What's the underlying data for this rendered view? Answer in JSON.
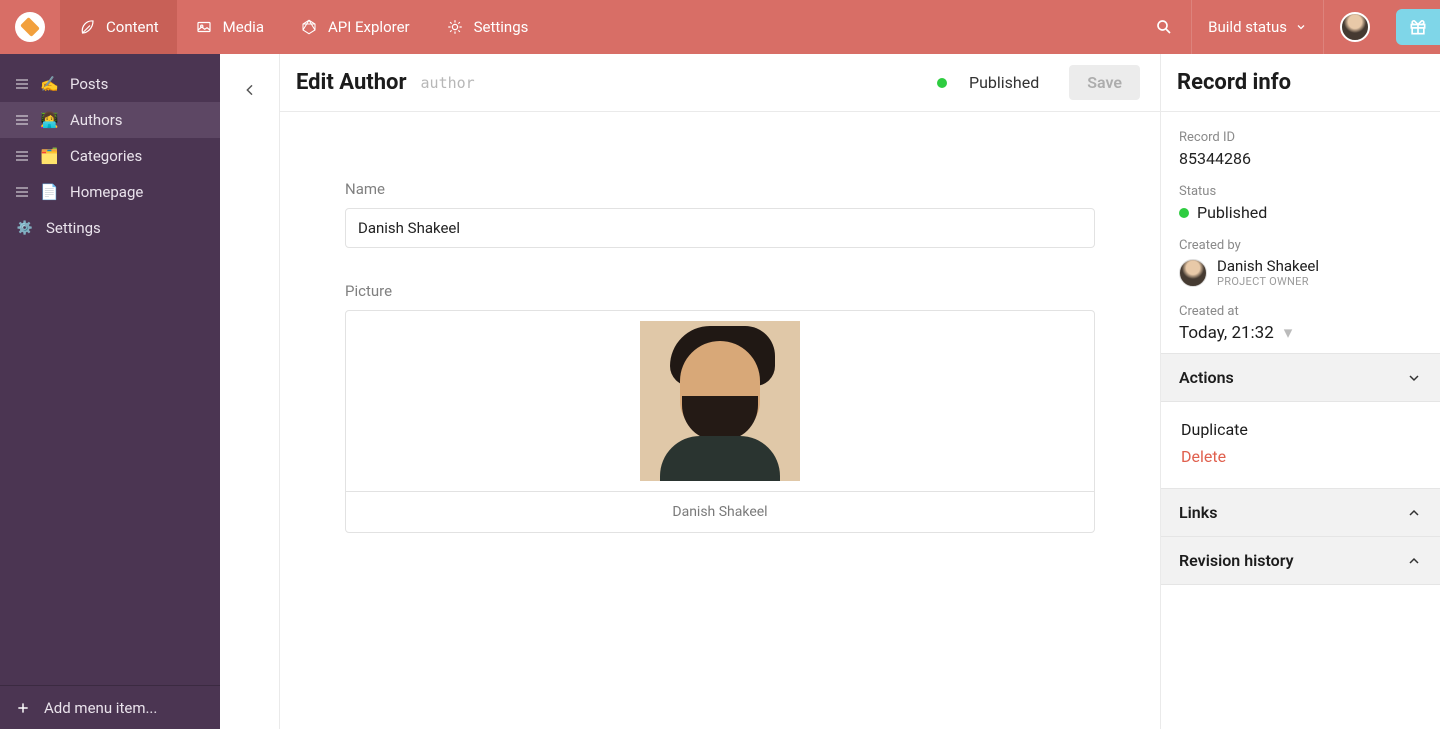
{
  "topnav": {
    "items": [
      {
        "label": "Content",
        "icon": "leaf-icon",
        "active": true
      },
      {
        "label": "Media",
        "icon": "images-icon",
        "active": false
      },
      {
        "label": "API Explorer",
        "icon": "graphql-icon",
        "active": false
      },
      {
        "label": "Settings",
        "icon": "cog-icon",
        "active": false
      }
    ],
    "build_status_label": "Build status"
  },
  "sidebar": {
    "items": [
      {
        "emoji": "✍️",
        "label": "Posts"
      },
      {
        "emoji": "👩‍💻",
        "label": "Authors"
      },
      {
        "emoji": "🗂️",
        "label": "Categories"
      },
      {
        "emoji": "📄",
        "label": "Homepage"
      }
    ],
    "active_index": 1,
    "settings_label": "Settings",
    "add_menu_label": "Add menu item..."
  },
  "editor": {
    "title": "Edit Author",
    "slug": "author",
    "published_label": "Published",
    "save_label": "Save",
    "fields": {
      "name_label": "Name",
      "name_value": "Danish Shakeel",
      "picture_label": "Picture",
      "picture_caption": "Danish Shakeel"
    }
  },
  "info": {
    "panel_title": "Record info",
    "record_id_label": "Record ID",
    "record_id_value": "85344286",
    "status_label": "Status",
    "status_value": "Published",
    "created_by_label": "Created by",
    "creator_name": "Danish Shakeel",
    "creator_role": "PROJECT OWNER",
    "created_at_label": "Created at",
    "created_at_value": "Today, 21:32",
    "sections": {
      "actions_label": "Actions",
      "links_label": "Links",
      "revision_label": "Revision history"
    },
    "actions": {
      "duplicate_label": "Duplicate",
      "delete_label": "Delete"
    }
  }
}
